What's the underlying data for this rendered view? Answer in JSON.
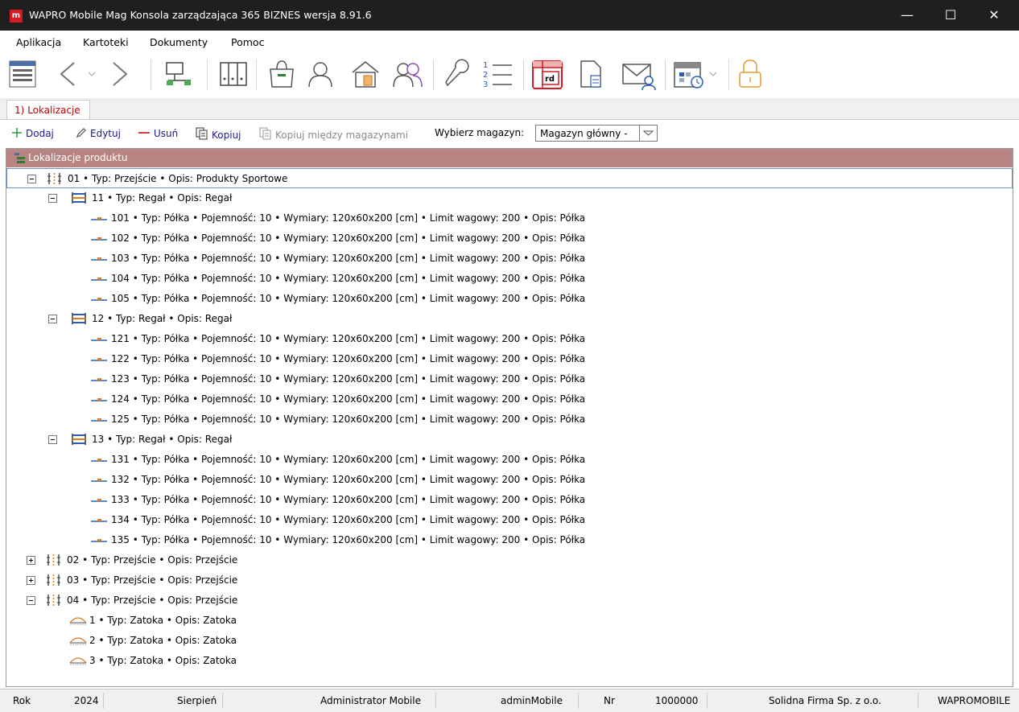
{
  "window": {
    "title": "WAPRO Mobile Mag Konsola zarządzająca 365 BIZNES wersja 8.91.6",
    "app_icon_letter": "m",
    "minimize": "—",
    "maximize": "☐",
    "close": "✕"
  },
  "menu": [
    "Aplikacja",
    "Kartoteki",
    "Dokumenty",
    "Pomoc"
  ],
  "toolbar_icons": [
    "window-list-icon",
    "back-arrow-icon",
    "forward-arrow-icon",
    "network-icon",
    "binders-icon",
    "shopping-bag-icon",
    "user-icon",
    "warehouse-icon",
    "users-icon",
    "wrench-icon",
    "numbered-list-icon",
    "report-icon",
    "document-icon",
    "mail-user-icon",
    "calendar-icon",
    "lock-icon"
  ],
  "report_icon_text": "rd",
  "tab": {
    "label": "1) Lokalizacje"
  },
  "actions": {
    "add": "Dodaj",
    "edit": "Edytuj",
    "delete": "Usuń",
    "copy": "Kopiuj",
    "copy_between": "Kopiuj między magazynami",
    "select_label": "Wybierz magazyn:",
    "select_value": "Magazyn główny -"
  },
  "tree": {
    "header": "Lokalizacje produktu",
    "rows": [
      {
        "level": 0,
        "exp": "minus",
        "icon": "aisle",
        "text": "01 • Typ: Przejście • Opis: Produkty Sportowe",
        "selected": true
      },
      {
        "level": 1,
        "exp": "minus",
        "icon": "rack",
        "text": "11 • Typ: Regał • Opis: Regał"
      },
      {
        "level": 2,
        "exp": "",
        "icon": "shelf",
        "text": "101 • Typ: Półka • Pojemność: 10 • Wymiary: 120x60x200 [cm] • Limit wagowy: 200 • Opis: Półka"
      },
      {
        "level": 2,
        "exp": "",
        "icon": "shelf",
        "text": "102 • Typ: Półka • Pojemność: 10 • Wymiary: 120x60x200 [cm] • Limit wagowy: 200 • Opis: Półka"
      },
      {
        "level": 2,
        "exp": "",
        "icon": "shelf",
        "text": "103 • Typ: Półka • Pojemność: 10 • Wymiary: 120x60x200 [cm] • Limit wagowy: 200 • Opis: Półka"
      },
      {
        "level": 2,
        "exp": "",
        "icon": "shelf",
        "text": "104 • Typ: Półka • Pojemność: 10 • Wymiary: 120x60x200 [cm] • Limit wagowy: 200 • Opis: Półka"
      },
      {
        "level": 2,
        "exp": "",
        "icon": "shelf",
        "text": "105 • Typ: Półka • Pojemność: 10 • Wymiary: 120x60x200 [cm] • Limit wagowy: 200 • Opis: Półka"
      },
      {
        "level": 1,
        "exp": "minus",
        "icon": "rack",
        "text": "12 • Typ: Regał • Opis: Regał"
      },
      {
        "level": 2,
        "exp": "",
        "icon": "shelf",
        "text": "121 • Typ: Półka • Pojemność: 10 • Wymiary: 120x60x200 [cm] • Limit wagowy: 200 • Opis: Półka"
      },
      {
        "level": 2,
        "exp": "",
        "icon": "shelf",
        "text": "122 • Typ: Półka • Pojemność: 10 • Wymiary: 120x60x200 [cm] • Limit wagowy: 200 • Opis: Półka"
      },
      {
        "level": 2,
        "exp": "",
        "icon": "shelf",
        "text": "123 • Typ: Półka • Pojemność: 10 • Wymiary: 120x60x200 [cm] • Limit wagowy: 200 • Opis: Półka"
      },
      {
        "level": 2,
        "exp": "",
        "icon": "shelf",
        "text": "124 • Typ: Półka • Pojemność: 10 • Wymiary: 120x60x200 [cm] • Limit wagowy: 200 • Opis: Półka"
      },
      {
        "level": 2,
        "exp": "",
        "icon": "shelf",
        "text": "125 • Typ: Półka • Pojemność: 10 • Wymiary: 120x60x200 [cm] • Limit wagowy: 200 • Opis: Półka"
      },
      {
        "level": 1,
        "exp": "minus",
        "icon": "rack",
        "text": "13 • Typ: Regał • Opis: Regał"
      },
      {
        "level": 2,
        "exp": "",
        "icon": "shelf",
        "text": "131 • Typ: Półka • Pojemność: 10 • Wymiary: 120x60x200 [cm] • Limit wagowy: 200 • Opis: Półka"
      },
      {
        "level": 2,
        "exp": "",
        "icon": "shelf",
        "text": "132 • Typ: Półka • Pojemność: 10 • Wymiary: 120x60x200 [cm] • Limit wagowy: 200 • Opis: Półka"
      },
      {
        "level": 2,
        "exp": "",
        "icon": "shelf",
        "text": "133 • Typ: Półka • Pojemność: 10 • Wymiary: 120x60x200 [cm] • Limit wagowy: 200 • Opis: Półka"
      },
      {
        "level": 2,
        "exp": "",
        "icon": "shelf",
        "text": "134 • Typ: Półka • Pojemność: 10 • Wymiary: 120x60x200 [cm] • Limit wagowy: 200 • Opis: Półka"
      },
      {
        "level": 2,
        "exp": "",
        "icon": "shelf",
        "text": "135 • Typ: Półka • Pojemność: 10 • Wymiary: 120x60x200 [cm] • Limit wagowy: 200 • Opis: Półka"
      },
      {
        "level": 0,
        "exp": "plus",
        "icon": "aisle",
        "text": "02 • Typ: Przejście • Opis: Przejście"
      },
      {
        "level": 0,
        "exp": "plus",
        "icon": "aisle",
        "text": "03 • Typ: Przejście • Opis: Przejście"
      },
      {
        "level": 0,
        "exp": "minus",
        "icon": "aisle",
        "text": "04 • Typ: Przejście • Opis: Przejście"
      },
      {
        "level": 1,
        "exp": "",
        "icon": "bay",
        "text": "1 • Typ: Zatoka • Opis: Zatoka"
      },
      {
        "level": 1,
        "exp": "",
        "icon": "bay",
        "text": "2 • Typ: Zatoka • Opis: Zatoka"
      },
      {
        "level": 1,
        "exp": "",
        "icon": "bay",
        "text": "3 • Typ: Zatoka • Opis: Zatoka"
      }
    ]
  },
  "status": {
    "year_label": "Rok",
    "year": "2024",
    "month": "Sierpień",
    "user_name": "Administrator Mobile",
    "login": "adminMobile",
    "nr_label": "Nr",
    "nr": "1000000",
    "company": "Solidna Firma Sp. z o.o.",
    "db": "WAPROMOBILE"
  },
  "colors": {
    "titlebar": "#1f1f1f",
    "accent_red": "#c00000",
    "tree_header": "#b98583",
    "link_blue": "#1a1a8c"
  }
}
